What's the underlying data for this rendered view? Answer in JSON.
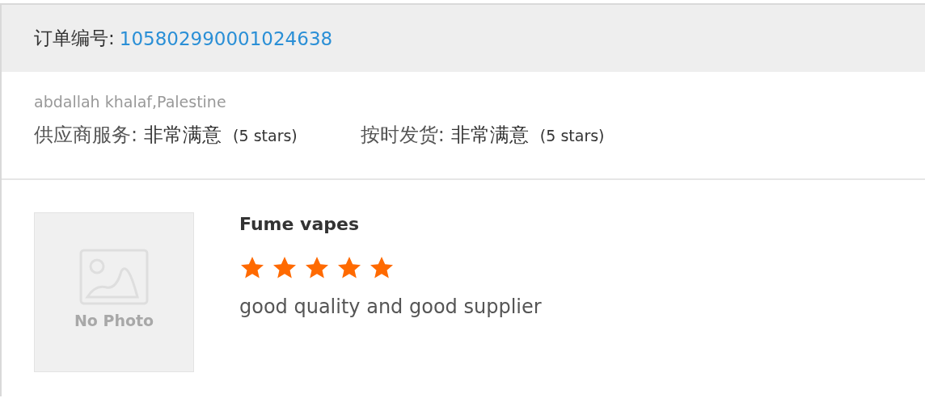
{
  "order": {
    "label": "订单编号:",
    "number": "105802990001024638"
  },
  "buyer": "abdallah khalaf,Palestine",
  "ratings": [
    {
      "label": "供应商服务:",
      "value": "非常满意",
      "note": "(5 stars)"
    },
    {
      "label": "按时发货:",
      "value": "非常满意",
      "note": "(5 stars)"
    }
  ],
  "product": {
    "photo_text": "No Photo",
    "name": "Fume vapes",
    "stars": 5,
    "comment": "good quality and good supplier"
  }
}
